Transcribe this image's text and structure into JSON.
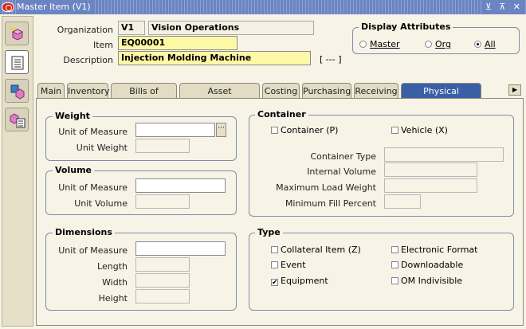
{
  "window": {
    "title": "Master Item (V1)",
    "controls": "⊻ ⊼ ✕"
  },
  "header": {
    "organization_label": "Organization",
    "organization_code": "V1",
    "organization_name": "Vision Operations",
    "item_label": "Item",
    "item_value": "EQ00001",
    "description_label": "Description",
    "description_value": "Injection Molding Machine",
    "dff_label": "[ --- ]"
  },
  "display_attributes": {
    "title": "Display Attributes",
    "options": [
      "Master",
      "Org",
      "All"
    ],
    "selected": "All"
  },
  "tabs": [
    {
      "label": "Main"
    },
    {
      "label": "Inventory"
    },
    {
      "label": "Bills of Material"
    },
    {
      "label": "Asset Management"
    },
    {
      "label": "Costing"
    },
    {
      "label": "Purchasing"
    },
    {
      "label": "Receiving"
    },
    {
      "label": "Physical Attributes"
    }
  ],
  "active_tab": "Physical Attributes",
  "weight": {
    "title": "Weight",
    "uom_label": "Unit of Measure",
    "uom_value": "",
    "unit_weight_label": "Unit Weight",
    "unit_weight_value": ""
  },
  "volume": {
    "title": "Volume",
    "uom_label": "Unit of Measure",
    "uom_value": "",
    "unit_volume_label": "Unit Volume",
    "unit_volume_value": ""
  },
  "dimensions": {
    "title": "Dimensions",
    "uom_label": "Unit of Measure",
    "length_label": "Length",
    "width_label": "Width",
    "height_label": "Height"
  },
  "container": {
    "title": "Container",
    "container_label": "Container (P)",
    "container_checked": false,
    "vehicle_label": "Vehicle (X)",
    "vehicle_checked": false,
    "container_type_label": "Container Type",
    "internal_volume_label": "Internal Volume",
    "max_load_weight_label": "Maximum Load Weight",
    "min_fill_percent_label": "Minimum Fill Percent"
  },
  "type": {
    "title": "Type",
    "collateral_label": "Collateral Item (Z)",
    "collateral_checked": false,
    "electronic_label": "Electronic Format",
    "electronic_checked": false,
    "event_label": "Event",
    "event_checked": false,
    "downloadable_label": "Downloadable",
    "downloadable_checked": false,
    "equipment_label": "Equipment",
    "equipment_checked": true,
    "om_indivisible_label": "OM Indivisible",
    "om_indivisible_checked": false
  }
}
